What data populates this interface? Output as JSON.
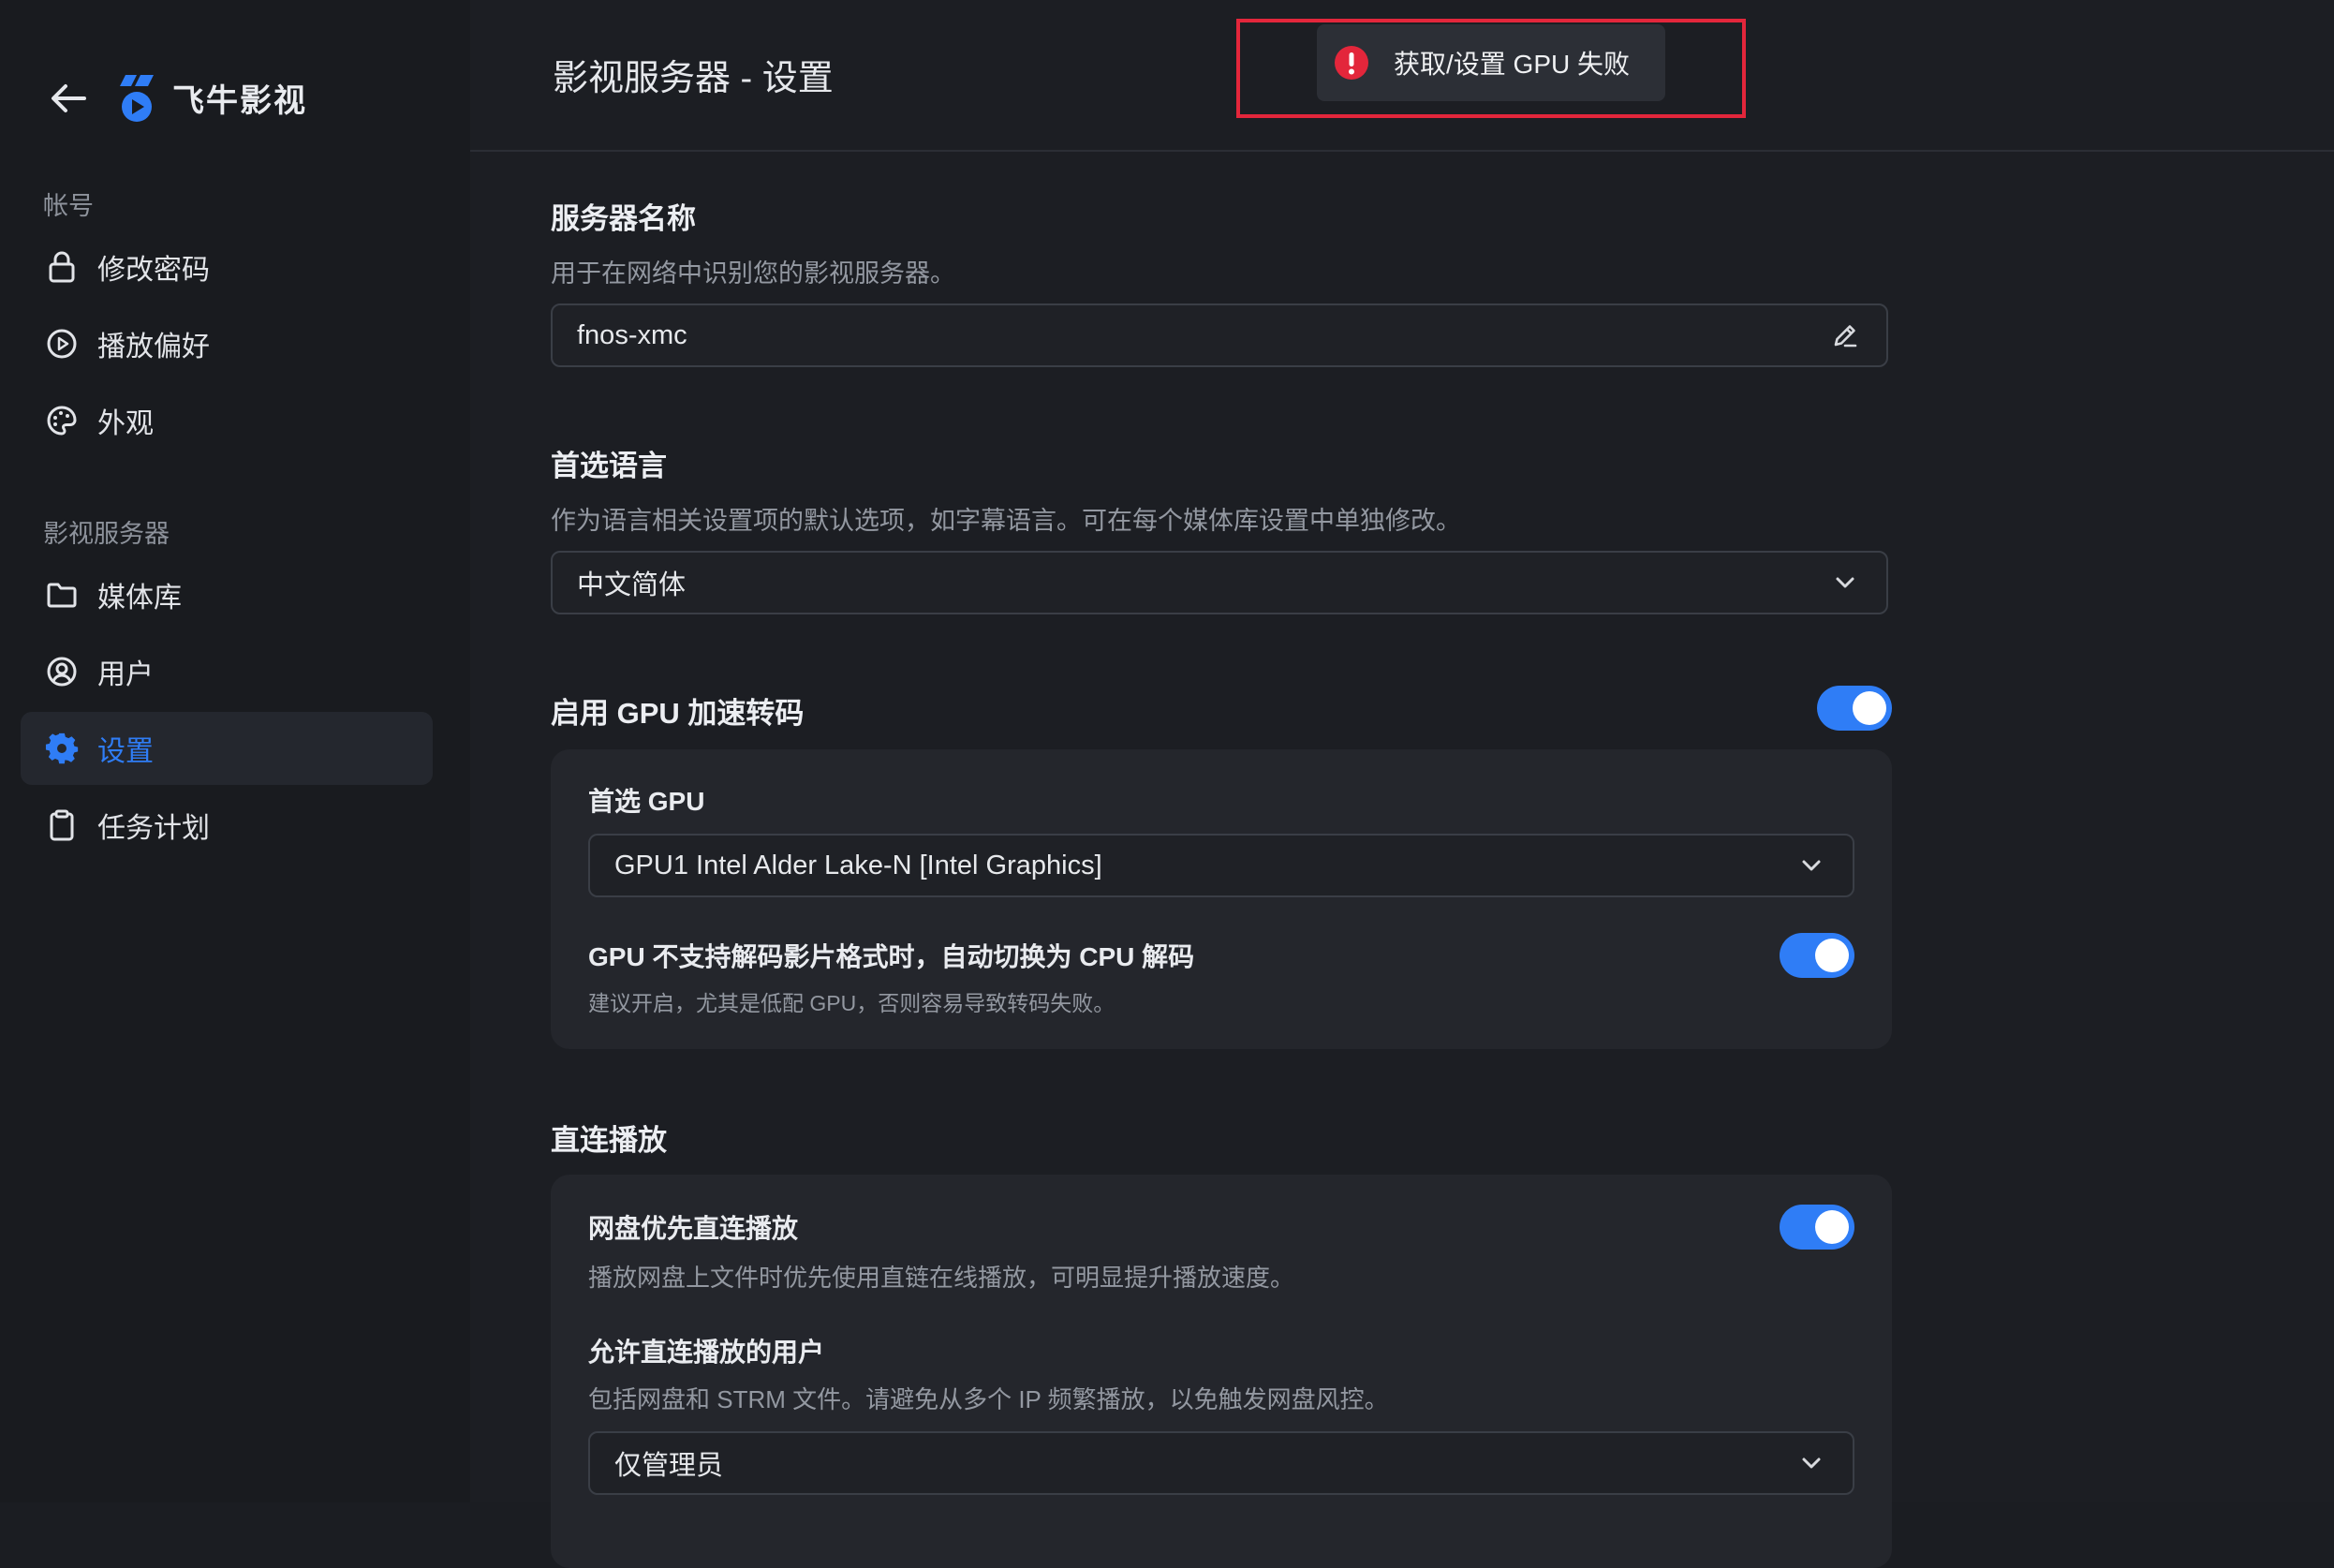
{
  "sidebar": {
    "brand": "飞牛影视",
    "sections": [
      {
        "label": "帐号"
      },
      {
        "label": "影视服务器"
      }
    ],
    "items": [
      {
        "label": "修改密码",
        "icon": "lock-icon"
      },
      {
        "label": "播放偏好",
        "icon": "play-circle-icon"
      },
      {
        "label": "外观",
        "icon": "palette-icon"
      },
      {
        "label": "媒体库",
        "icon": "folder-icon"
      },
      {
        "label": "用户",
        "icon": "user-circle-icon"
      },
      {
        "label": "设置",
        "icon": "gear-icon",
        "active": true
      },
      {
        "label": "任务计划",
        "icon": "clipboard-icon"
      }
    ]
  },
  "header": {
    "title": "影视服务器 - 设置"
  },
  "toast": {
    "message": "获取/设置 GPU 失败",
    "type": "error"
  },
  "server_name": {
    "title": "服务器名称",
    "description": "用于在网络中识别您的影视服务器。",
    "value": "fnos-xmc"
  },
  "language": {
    "title": "首选语言",
    "description": "作为语言相关设置项的默认选项，如字幕语言。可在每个媒体库设置中单独修改。",
    "value": "中文简体"
  },
  "gpu": {
    "title": "启用 GPU 加速转码",
    "enabled": true,
    "preferred_label": "首选 GPU",
    "preferred_value": "GPU1 Intel Alder Lake-N [Intel Graphics]",
    "fallback_title": "GPU 不支持解码影片格式时，自动切换为 CPU 解码",
    "fallback_desc": "建议开启，尤其是低配 GPU，否则容易导致转码失败。",
    "fallback_enabled": true
  },
  "direct_play": {
    "title": "直连播放",
    "netdisk_title": "网盘优先直连播放",
    "netdisk_desc": "播放网盘上文件时优先使用直链在线播放，可明显提升播放速度。",
    "netdisk_enabled": true,
    "users_title": "允许直连播放的用户",
    "users_desc": "包括网盘和 STRM 文件。请避免从多个 IP 频繁播放，以免触发网盘风控。",
    "users_value": "仅管理员"
  },
  "colors": {
    "accent": "#2f7df6",
    "error": "#e3263b",
    "background": "#1c1e23",
    "sidebar": "#191b1f"
  }
}
